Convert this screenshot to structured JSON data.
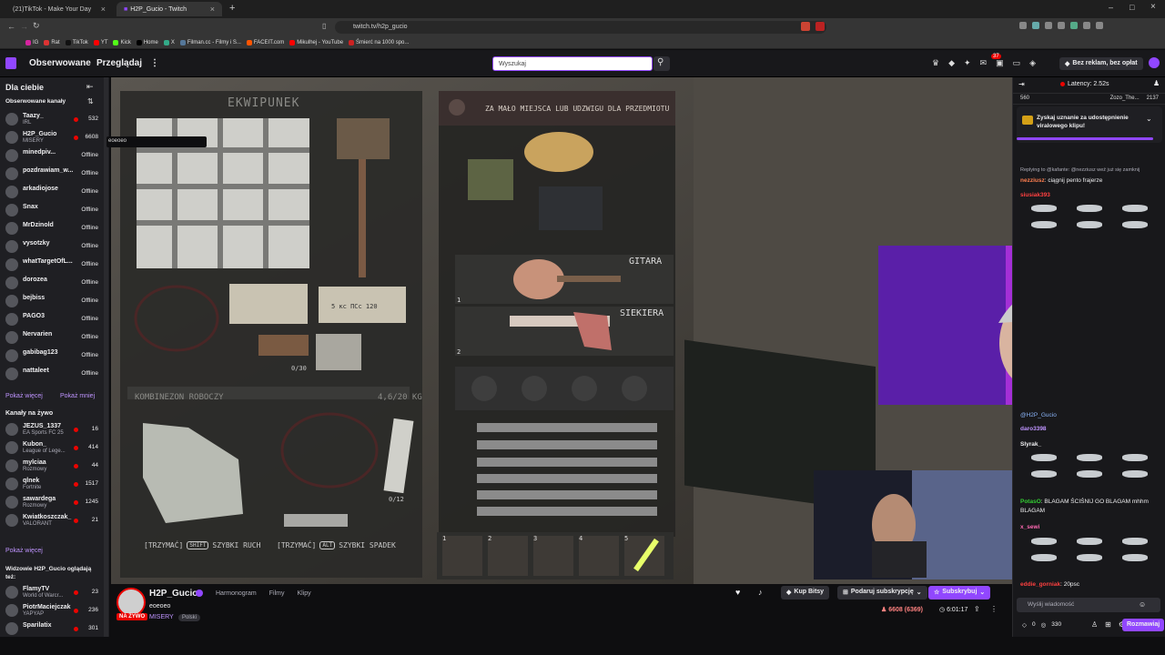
{
  "browser": {
    "tabs": [
      {
        "label": "(21)TikTok - Make Your Day"
      },
      {
        "label": "H2P_Gucio - Twitch"
      }
    ],
    "url": "twitch.tv/h2p_gucio",
    "bookmarks": [
      "IG",
      "Rat",
      "TikTok",
      "YT",
      "Kick",
      "Home",
      "X",
      "Filman.cc - Filmy i S...",
      "FACEIT.com",
      "Mikulhej - YouTube",
      "Śmierć na 1000 spo..."
    ]
  },
  "topnav": {
    "following": "Obserwowane",
    "browse": "Przeglądaj",
    "search_placeholder": "Wyszukaj",
    "adfree": "Bez reklam, bez opłat",
    "notif_count": "37"
  },
  "sidebar": {
    "for_you": "Dla ciebie",
    "followed_header": "Obserwowane kanały",
    "followed": [
      {
        "name": "Taazy_",
        "game": "IRL",
        "viewers": "532",
        "live": true
      },
      {
        "name": "H2P_Gucio",
        "game": "MISERY",
        "viewers": "6608",
        "live": true
      },
      {
        "name": "minedpiv...",
        "game": "",
        "viewers": "Offline",
        "live": false
      },
      {
        "name": "pozdrawiam_w...",
        "game": "",
        "viewers": "Offline",
        "live": false
      },
      {
        "name": "arkadiojose",
        "game": "",
        "viewers": "Offline",
        "live": false
      },
      {
        "name": "Snax",
        "game": "",
        "viewers": "Offline",
        "live": false
      },
      {
        "name": "MrDzinold",
        "game": "",
        "viewers": "Offline",
        "live": false
      },
      {
        "name": "vysotzky",
        "game": "",
        "viewers": "Offline",
        "live": false
      },
      {
        "name": "whatTargetOfL...",
        "game": "",
        "viewers": "Offline",
        "live": false
      },
      {
        "name": "dorozea",
        "game": "",
        "viewers": "Offline",
        "live": false
      },
      {
        "name": "bejbiss",
        "game": "",
        "viewers": "Offline",
        "live": false
      },
      {
        "name": "PAGO3",
        "game": "",
        "viewers": "Offline",
        "live": false
      },
      {
        "name": "Nervarien",
        "game": "",
        "viewers": "Offline",
        "live": false
      },
      {
        "name": "gabibag123",
        "game": "",
        "viewers": "Offline",
        "live": false
      },
      {
        "name": "nattaleet",
        "game": "",
        "viewers": "Offline",
        "live": false
      }
    ],
    "tooltip": "eoeoeo",
    "show_more": "Pokaż więcej",
    "show_less": "Pokaż mniej",
    "live_header": "Kanały na żywo",
    "live": [
      {
        "name": "JEZUS_1337",
        "game": "EA Sports FC 25",
        "viewers": "16"
      },
      {
        "name": "Kubon_",
        "game": "League of Lege...",
        "viewers": "414"
      },
      {
        "name": "mylciaa",
        "game": "Rozmowy",
        "viewers": "44"
      },
      {
        "name": "qlnek",
        "game": "Fortnite",
        "viewers": "1517"
      },
      {
        "name": "sawardega",
        "game": "Rozmowy",
        "viewers": "1245"
      },
      {
        "name": "Kwiatkoszczak_",
        "game": "VALORANT",
        "viewers": "21"
      }
    ],
    "show_more2": "Pokaż więcej",
    "viewers_header": "Widzowie H2P_Gucio oglądają też:",
    "also": [
      {
        "name": "FlamyTV",
        "game": "World of Warcr...",
        "viewers": "23"
      },
      {
        "name": "PiotrMaciejczak",
        "game": "YAPYAP",
        "viewers": "236"
      },
      {
        "name": "Sparilatix",
        "game": "",
        "viewers": "301"
      }
    ]
  },
  "game": {
    "left_title": "EKWIPUNEK",
    "warning": "ZA MAŁO MIEJSCA LUB UDZWIGU DLA PRZEDMIOTU",
    "capacity1": "0/30",
    "bill_text": "5 кс ПСс 120",
    "suit_title": "KOMBINEZON ROBOCZY",
    "suit_weight": "4,6/20 KG",
    "capacity2": "0/12",
    "guitar": "GITARA",
    "axe": "SIEKIERA",
    "slot1": "1",
    "slot2": "2",
    "hint1_a": "[TRZYMAĆ]",
    "hint1_key": "SHIFT",
    "hint1_b": "SZYBKI RUCH",
    "hint2_a": "[TRZYMAĆ]",
    "hint2_key": "ALT",
    "hint2_b": "SZYBKI SPADEK",
    "hotbar": [
      "1",
      "2",
      "3",
      "4",
      "5"
    ]
  },
  "channel": {
    "name": "H2P_Gucio",
    "title": "eoeoeo",
    "game": "MISERY",
    "live_badge": "NA ŻYWO",
    "lang": "Polski",
    "tabs": [
      "Harmonogram",
      "Filmy",
      "Klipy"
    ],
    "bits": "Kup Bitsy",
    "gift": "Podaruj subskrypcję",
    "subscribe": "Subskrybuj",
    "viewers": "6608 (6369)",
    "uptime": "6:01:17"
  },
  "chat": {
    "latency": "Latency: 2.52s",
    "top_viewers": [
      "560",
      "Zozo_The...",
      "2137"
    ],
    "promo": "Zyskaj uznanie za udostępnienie viralowego klipu!",
    "messages": [
      {
        "user": "",
        "text": "Replying to @kafante: @nezziusz weź już się zamknij"
      },
      {
        "user": "nezziusz",
        "text": "ciągnij pento frajerze"
      },
      {
        "user": "siusiak393",
        "text": ""
      },
      {
        "user": "",
        "text": "@H2P_Gucio"
      },
      {
        "user": "daro3398",
        "text": ""
      },
      {
        "user": "Slyrak_",
        "text": ""
      },
      {
        "user": "PotasO",
        "text": "BLAGAM ŚCIŚNIJ GO BLAGAM mhhm BLAGAM"
      },
      {
        "user": "x_sewi",
        "text": ""
      },
      {
        "user": "eddie_gorniak",
        "text": "20psc"
      }
    ],
    "input_placeholder": "Wyślij wiadomość",
    "points": "0",
    "points2": "330",
    "send": "Rozmawiaj"
  },
  "colors": {
    "accent": "#9147ff",
    "live": "#eb0400",
    "link": "#bf94ff"
  }
}
